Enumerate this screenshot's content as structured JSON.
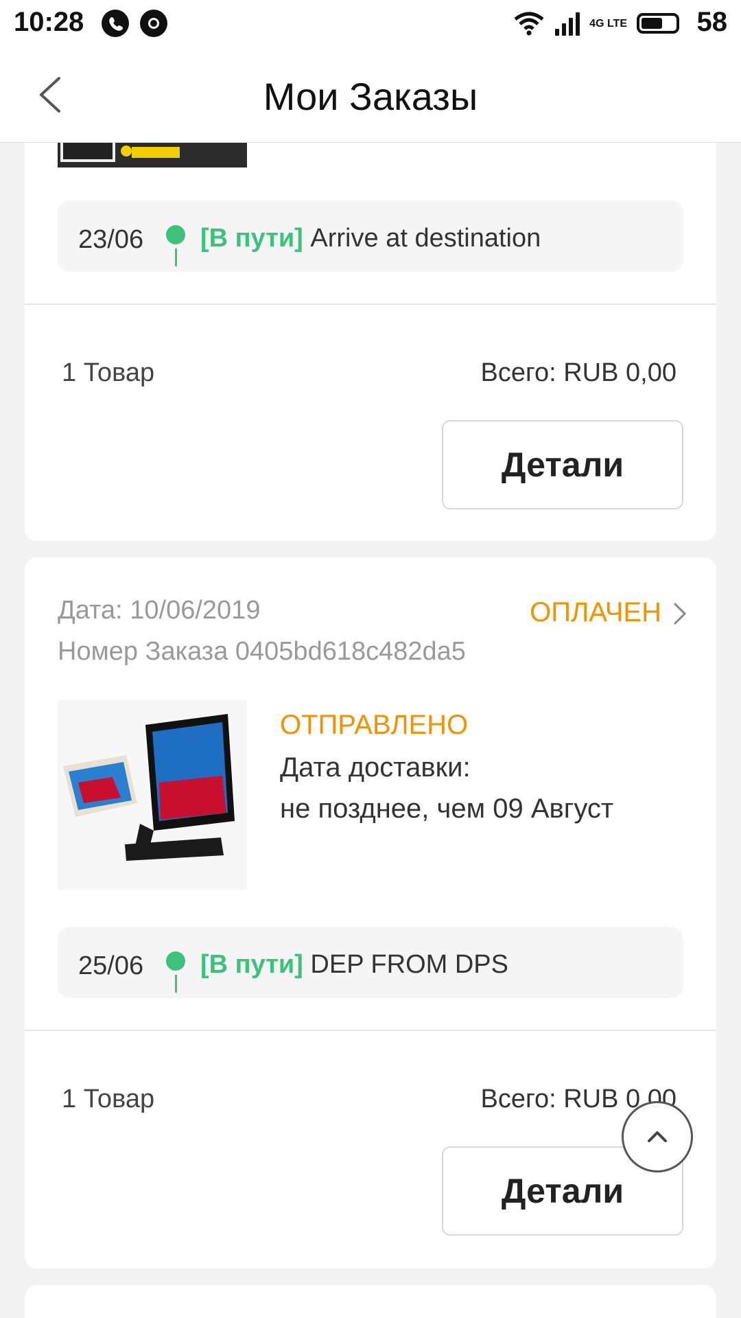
{
  "status_bar": {
    "time": "10:28",
    "battery": "58",
    "network": "4G LTE"
  },
  "header": {
    "title": "Мои Заказы"
  },
  "orders": [
    {
      "tracking": {
        "date": "23/06",
        "status": "[В пути]",
        "message": "Arrive at destination"
      },
      "items_count": "1 Товар",
      "total": "Всего: RUB 0,00",
      "details_label": "Детали"
    },
    {
      "date": "Дата: 10/06/2019",
      "order_number": "Номер Заказа 0405bd618c482da5",
      "status": "ОПЛАЧЕН",
      "shipment_status": "ОТПРАВЛЕНО",
      "delivery_label": "Дата доставки:",
      "delivery_value": "не позднее, чем 09 Август",
      "tracking": {
        "date": "25/06",
        "status": "[В пути]",
        "message": "DEP FROM DPS"
      },
      "items_count": "1 Товар",
      "total": "Всего: RUB 0,00",
      "details_label": "Детали"
    }
  ],
  "colors": {
    "accent_orange": "#f39200",
    "tracking_green": "#3cc27a",
    "background": "#f2f2f2"
  },
  "icons": [
    "back-arrow-icon",
    "chevron-right-icon",
    "scroll-to-top-icon",
    "whatsapp-icon",
    "chrome-icon",
    "wifi-icon",
    "signal-icon",
    "battery-icon"
  ]
}
